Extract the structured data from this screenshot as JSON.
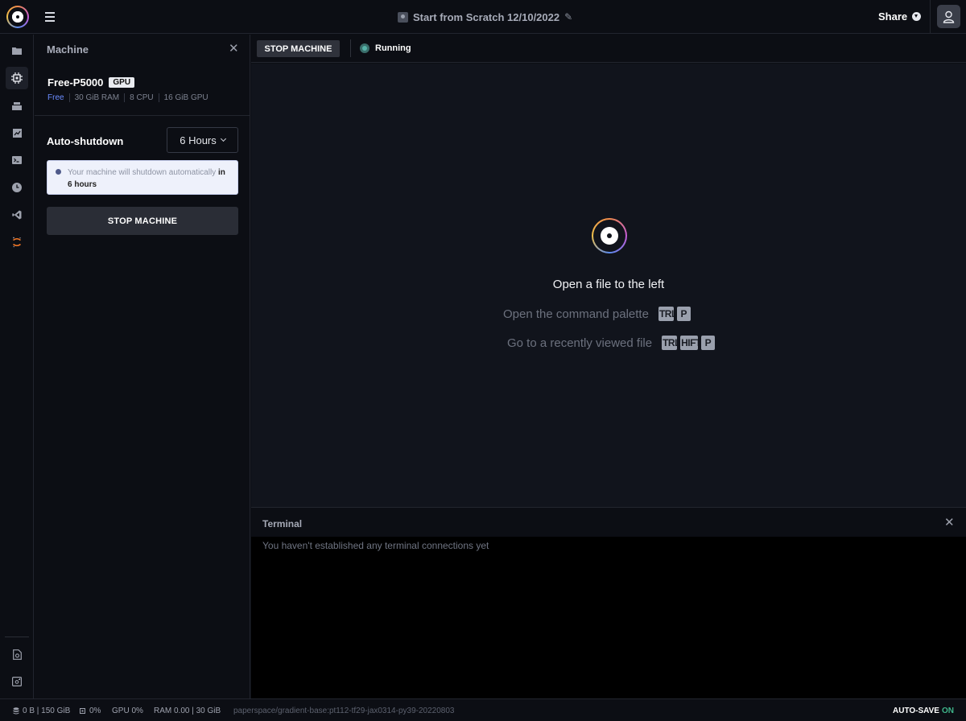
{
  "header": {
    "notebook_title": "Start from Scratch 12/10/2022",
    "share_label": "Share"
  },
  "rail": {
    "items": [
      "folder-icon",
      "chip-icon",
      "stack-icon",
      "chart-icon",
      "terminal-icon",
      "clock-icon",
      "vscode-icon",
      "jupyter-icon"
    ],
    "bottom_items": [
      "settings-file-icon",
      "help-icon"
    ],
    "active_item": "chip-icon"
  },
  "panel": {
    "title": "Machine",
    "machine_name": "Free-P5000",
    "gpu_badge": "GPU",
    "specs": [
      "Free",
      "30 GiB RAM",
      "8 CPU",
      "16 GiB GPU"
    ],
    "auto_shutdown_label": "Auto-shutdown",
    "auto_shutdown_value": "6 Hours",
    "info_text": "Your machine will shutdown automatically",
    "info_in": "in",
    "info_hours": "6 hours",
    "stop_button": "STOP MACHINE"
  },
  "toolbar": {
    "stop_button": "STOP MACHINE",
    "status": "Running"
  },
  "editor": {
    "open_file": "Open a file to the left",
    "command_palette_label": "Open the command palette",
    "command_palette_keys": [
      "TRL",
      "P"
    ],
    "recent_label": "Go to a recently viewed file",
    "recent_keys": [
      "TRL",
      "HIFT",
      "P"
    ]
  },
  "terminal": {
    "title": "Terminal",
    "message": "You haven't established any terminal connections yet"
  },
  "statusbar": {
    "storage": "0 B | 150 GiB",
    "cpu": "0%",
    "gpu": "GPU 0%",
    "ram": "RAM 0.00 | 30 GiB",
    "image": "paperspace/gradient-base:pt112-tf29-jax0314-py39-20220803",
    "autosave_label": "AUTO-SAVE",
    "autosave_value": "ON"
  },
  "colors": {
    "accent_blue": "#6b8cff",
    "running_green": "#56b3a8",
    "autosave_green": "#3fb58a"
  }
}
